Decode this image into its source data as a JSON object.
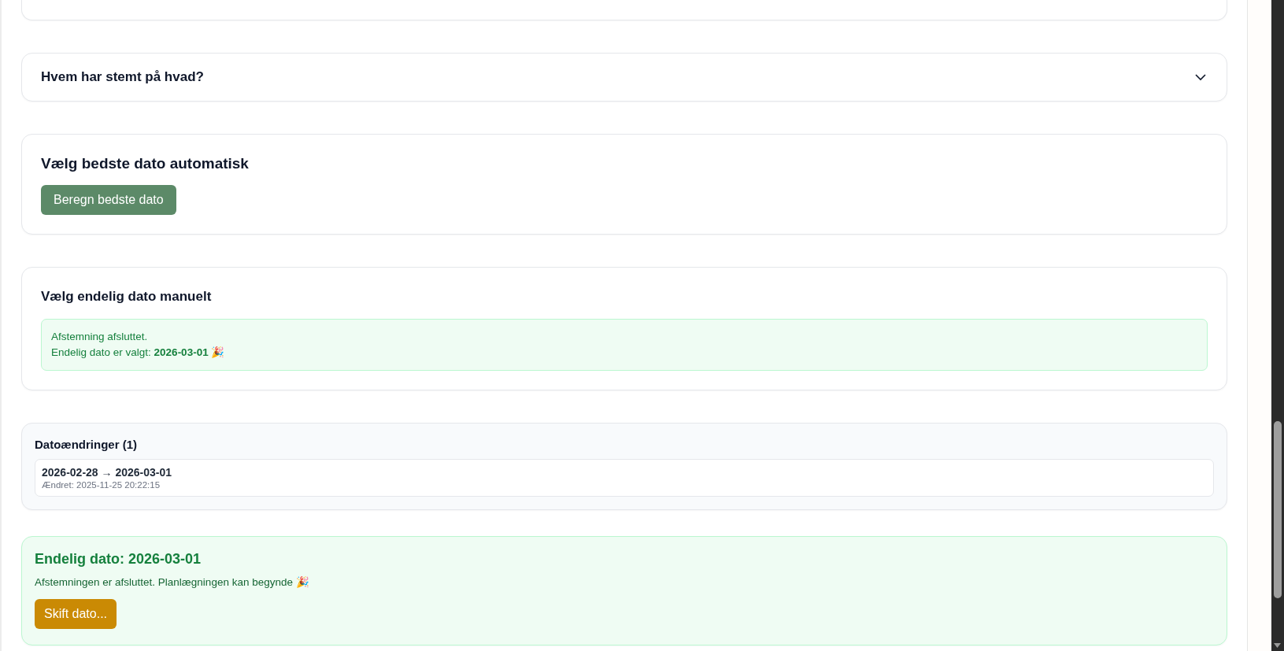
{
  "voters_section": {
    "title": "Hvem har stemt på hvad?",
    "expanded": false
  },
  "auto_pick": {
    "title": "Vælg bedste dato automatisk",
    "button": "Beregn bedste dato"
  },
  "manual_pick": {
    "title": "Vælg endelig dato manuelt",
    "notice_lines": [
      "Afstemning afsluttet.",
      "Endelig dato er valgt: **2026-03-01** 🎉"
    ]
  },
  "date_changes": {
    "title": "Datoændringer (1)",
    "items": [
      {
        "change": "2026-02-28 → 2026-03-01",
        "changed_at": "Ændret: 2025-11-25 20:22:15"
      }
    ]
  },
  "final": {
    "title": "Endelig dato: 2026-03-01",
    "message": "Afstemningen er afsluttet. Planlægningen kan begynde 🎉",
    "button": "Skift dato..."
  }
}
